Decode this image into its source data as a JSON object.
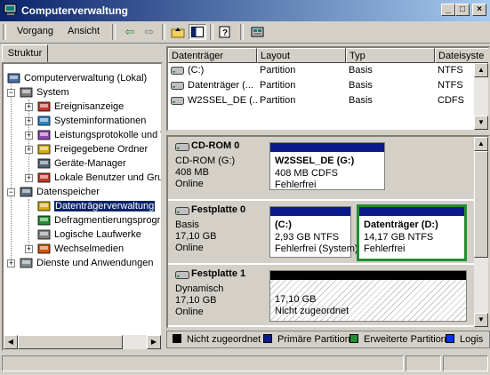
{
  "window": {
    "title": "Computerverwaltung"
  },
  "caption_buttons": {
    "minimize": "_",
    "maximize": "□",
    "close": "×"
  },
  "menu": {
    "vorgang": "Vorgang",
    "ansicht": "Ansicht"
  },
  "toolbar_icons": [
    "back-arrow-icon",
    "forward-arrow-icon",
    "up-folder-icon",
    "show-tree-icon",
    "help-icon",
    "properties-icon"
  ],
  "left_tab": "Struktur",
  "tree": [
    {
      "label": "Computerverwaltung (Lokal)",
      "icon": "computer-icon"
    },
    {
      "label": "System",
      "icon": "tools-icon"
    },
    {
      "label": "Ereignisanzeige",
      "icon": "event-viewer-icon"
    },
    {
      "label": "Systeminformationen",
      "icon": "system-info-icon"
    },
    {
      "label": "Leistungsprotokolle und W",
      "icon": "performance-icon"
    },
    {
      "label": "Freigegebene Ordner",
      "icon": "shared-folder-icon"
    },
    {
      "label": "Geräte-Manager",
      "icon": "device-manager-icon"
    },
    {
      "label": "Lokale Benutzer und Grup",
      "icon": "users-icon"
    },
    {
      "label": "Datenspeicher",
      "icon": "storage-icon"
    },
    {
      "label": "Datenträgerverwaltung",
      "icon": "disk-management-icon"
    },
    {
      "label": "Defragmentierungsprogr",
      "icon": "defrag-icon"
    },
    {
      "label": "Logische Laufwerke",
      "icon": "logical-drives-icon"
    },
    {
      "label": "Wechselmedien",
      "icon": "removable-media-icon"
    },
    {
      "label": "Dienste und Anwendungen",
      "icon": "services-icon"
    }
  ],
  "volume_list": {
    "columns": [
      "Datenträger",
      "Layout",
      "Typ",
      "Dateisyste"
    ],
    "rows": [
      {
        "name": "(C:)",
        "layout": "Partition",
        "type": "Basis",
        "fs": "NTFS",
        "icon": "drive-icon"
      },
      {
        "name": "Datenträger (...",
        "layout": "Partition",
        "type": "Basis",
        "fs": "NTFS",
        "icon": "drive-icon"
      },
      {
        "name": "W2SSEL_DE (...",
        "layout": "Partition",
        "type": "Basis",
        "fs": "CDFS",
        "icon": "cd-drive-icon"
      }
    ]
  },
  "disks": [
    {
      "name": "CD-ROM 0",
      "line1": "CD-ROM (G:)",
      "line2": "408 MB",
      "line3": "Online",
      "icon": "cdrom-icon",
      "partitions": [
        {
          "title": "W2SSEL_DE (G:)",
          "size": "408 MB CDFS",
          "status": "Fehlerfrei"
        }
      ]
    },
    {
      "name": "Festplatte 0",
      "line1": "Basis",
      "line2": "17,10 GB",
      "line3": "Online",
      "icon": "harddisk-icon",
      "partitions": [
        {
          "title": "(C:)",
          "size": "2,93 GB NTFS",
          "status": "Fehlerfrei (System)"
        },
        {
          "title": "Datenträger (D:)",
          "size": "14,17 GB NTFS",
          "status": "Fehlerfrei"
        }
      ]
    },
    {
      "name": "Festplatte 1",
      "line1": "Dynamisch",
      "line2": "17,10 GB",
      "line3": "Online",
      "icon": "harddisk-icon",
      "partitions": [
        {
          "title": "",
          "size": "17,10 GB",
          "status": "Nicht zugeordnet"
        }
      ]
    }
  ],
  "legend": [
    {
      "label": "Nicht zugeordnet",
      "color": "#000000"
    },
    {
      "label": "Primäre Partition",
      "color": "#0a1a8c"
    },
    {
      "label": "Erweiterte Partition",
      "color": "#1f8f2f"
    },
    {
      "label": "Logis",
      "color": "#0033ff"
    }
  ],
  "colors": {
    "titlebar_start": "#0a246a",
    "titlebar_end": "#a6caf0",
    "selection": "#0a246a",
    "primary_partition": "#0a1a8c",
    "extended_partition": "#1f8f2f",
    "unallocated": "#000000"
  }
}
